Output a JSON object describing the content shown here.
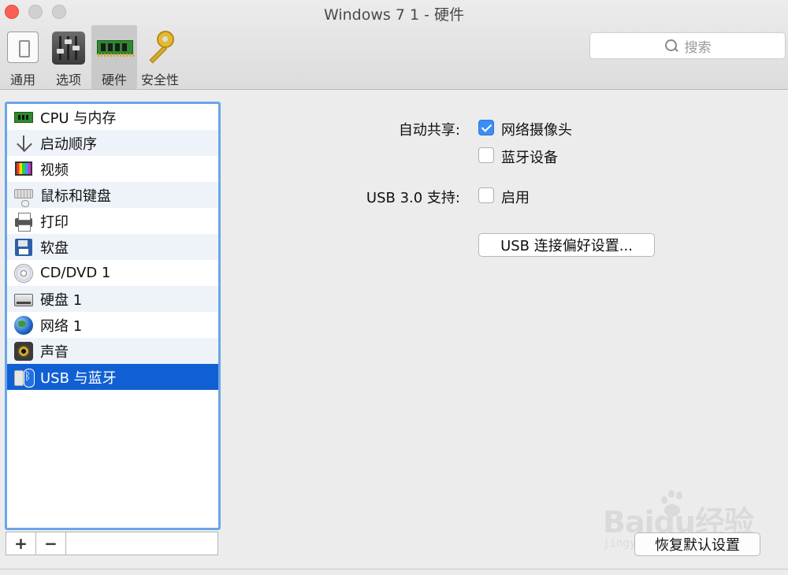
{
  "window": {
    "title": "Windows 7 1 - 硬件"
  },
  "toolbar": {
    "items": [
      {
        "label": "通用",
        "icon": "switch-icon"
      },
      {
        "label": "选项",
        "icon": "sliders-icon"
      },
      {
        "label": "硬件",
        "icon": "ram-icon",
        "active": true
      },
      {
        "label": "安全性",
        "icon": "key-icon"
      }
    ]
  },
  "search": {
    "placeholder": "搜索"
  },
  "sidebar": {
    "items": [
      {
        "label": "CPU 与内存",
        "icon": "cpu-icon"
      },
      {
        "label": "启动顺序",
        "icon": "boot-order-icon"
      },
      {
        "label": "视频",
        "icon": "video-icon"
      },
      {
        "label": "鼠标和键盘",
        "icon": "keyboard-icon"
      },
      {
        "label": "打印",
        "icon": "printer-icon"
      },
      {
        "label": "软盘",
        "icon": "floppy-icon"
      },
      {
        "label": "CD/DVD 1",
        "icon": "cd-icon"
      },
      {
        "label": "硬盘 1",
        "icon": "hard-disk-icon"
      },
      {
        "label": "网络 1",
        "icon": "network-globe-icon"
      },
      {
        "label": "声音",
        "icon": "speaker-icon"
      },
      {
        "label": "USB 与蓝牙",
        "icon": "usb-bluetooth-icon",
        "selected": true
      }
    ],
    "add_label": "+",
    "remove_label": "−"
  },
  "content": {
    "auto_share_label": "自动共享:",
    "webcam_label": "网络摄像头",
    "webcam_checked": true,
    "bluetooth_label": "蓝牙设备",
    "bluetooth_checked": false,
    "usb3_label": "USB 3.0 支持:",
    "enable_label": "启用",
    "enable_checked": false,
    "usb_prefs_button": "USB 连接偏好设置...",
    "restore_defaults_button": "恢复默认设置"
  },
  "watermark": {
    "text": "Baidu经验",
    "sub": "jingyan.baidu.com"
  },
  "colors": {
    "selection": "#1160d3",
    "checkbox": "#3b8ef5",
    "list_border": "#6aa6e8"
  }
}
